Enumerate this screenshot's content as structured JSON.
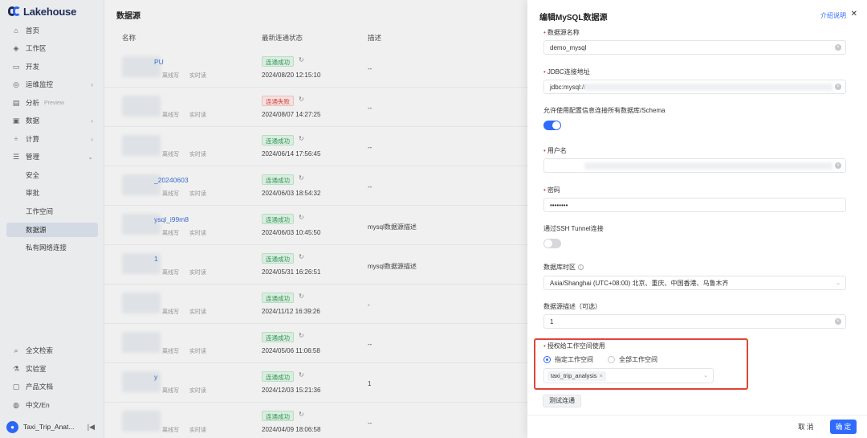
{
  "app": {
    "logo_text": "Lakehouse"
  },
  "sidebar": {
    "items": [
      {
        "label": "首页",
        "icon": "home-icon"
      },
      {
        "label": "工作区",
        "icon": "cube-icon"
      },
      {
        "label": "开发",
        "icon": "folder-icon"
      },
      {
        "label": "运维监控",
        "icon": "monitor-icon"
      },
      {
        "label": "分析",
        "icon": "analysis-icon",
        "tag": "Preview"
      },
      {
        "label": "数据",
        "icon": "database-icon"
      },
      {
        "label": "计算",
        "icon": "compute-icon"
      },
      {
        "label": "管理",
        "icon": "settings-icon"
      }
    ],
    "sub_items": [
      "安全",
      "审批",
      "工作空间",
      "数据源",
      "私有网络连接"
    ],
    "bottom_items": [
      {
        "label": "全文检索",
        "icon": "search-icon"
      },
      {
        "label": "实验室",
        "icon": "lab-icon"
      },
      {
        "label": "产品文档",
        "icon": "doc-icon"
      },
      {
        "label": "中文/En",
        "icon": "globe-icon"
      }
    ],
    "user": "Taxi_Trip_Anat..."
  },
  "main": {
    "title": "数据源",
    "columns": [
      "名称",
      "最新连通状态",
      "描述"
    ],
    "rows": [
      {
        "name": "PU",
        "tags": [
          "离线写",
          "实时读"
        ],
        "status": "连通成功",
        "status_type": "ok",
        "time": "2024/08/20 12:15:10",
        "desc": "--"
      },
      {
        "name": "",
        "tags": [
          "离线写",
          "实时读"
        ],
        "status": "连通失败",
        "status_type": "fail",
        "time": "2024/08/07 14:27:25",
        "desc": "--"
      },
      {
        "name": "",
        "tags": [
          "离线写",
          "实时读"
        ],
        "status": "连通成功",
        "status_type": "ok",
        "time": "2024/06/14 17:56:45",
        "desc": "--"
      },
      {
        "name": "_20240603",
        "tags": [
          "离线写",
          "实时读"
        ],
        "status": "连通成功",
        "status_type": "ok",
        "time": "2024/06/03 18:54:32",
        "desc": "--"
      },
      {
        "name": "ysql_i99m8",
        "tags": [
          "离线写",
          "实时读"
        ],
        "status": "连通成功",
        "status_type": "ok",
        "time": "2024/06/03 10:45:50",
        "desc": "mysql数据源描述"
      },
      {
        "name": "1",
        "tags": [
          "离线写",
          "实时读"
        ],
        "status": "连通成功",
        "status_type": "ok",
        "time": "2024/05/31 16:26:51",
        "desc": "mysql数据源描述"
      },
      {
        "name": "",
        "tags": [
          "离线写",
          "实时读"
        ],
        "status": "连通成功",
        "status_type": "ok",
        "time": "2024/11/12 16:39:26",
        "desc": "-"
      },
      {
        "name": "",
        "tags": [
          "离线写",
          "实时读"
        ],
        "status": "连通成功",
        "status_type": "ok",
        "time": "2024/05/06 11:06:58",
        "desc": "--"
      },
      {
        "name": "y",
        "tags": [
          "离线写",
          "实时读"
        ],
        "status": "连通成功",
        "status_type": "ok",
        "time": "2024/12/03 15:21:36",
        "desc": "1"
      },
      {
        "name": "",
        "tags": [
          "离线写",
          "实时读"
        ],
        "status": "连通成功",
        "status_type": "ok",
        "time": "2024/04/09 18:06:58",
        "desc": "--"
      }
    ]
  },
  "drawer": {
    "title": "编辑MySQL数据源",
    "help": "介绍说明",
    "fields": {
      "name_label": "数据源名称",
      "name_value": "demo_mysql",
      "jdbc_label": "JDBC连接地址",
      "jdbc_value": "jdbc:mysql://",
      "allow_all_label": "允许使用配置信息连接所有数据库/Schema",
      "username_label": "用户名",
      "password_label": "密码",
      "password_value": "••••••••",
      "ssh_label": "通过SSH Tunnel连接",
      "timezone_label": "数据库时区",
      "timezone_value": "Asia/Shanghai (UTC+08:00) 北京、重庆、中国香港、乌鲁木齐",
      "desc_label": "数据源描述（可选）",
      "desc_value": "1",
      "auth_label": "授权给工作空间使用",
      "radio_specific": "指定工作空间",
      "radio_all": "全部工作空间",
      "workspace_chip": "taxi_trip_analysis"
    },
    "test_button": "测试连通",
    "cancel_button": "取 消",
    "ok_button": "确 定"
  },
  "colors": {
    "accent": "#2f6bff",
    "success": "#2e9d55",
    "error": "#e0453a",
    "highlight_border": "#e0453a"
  }
}
